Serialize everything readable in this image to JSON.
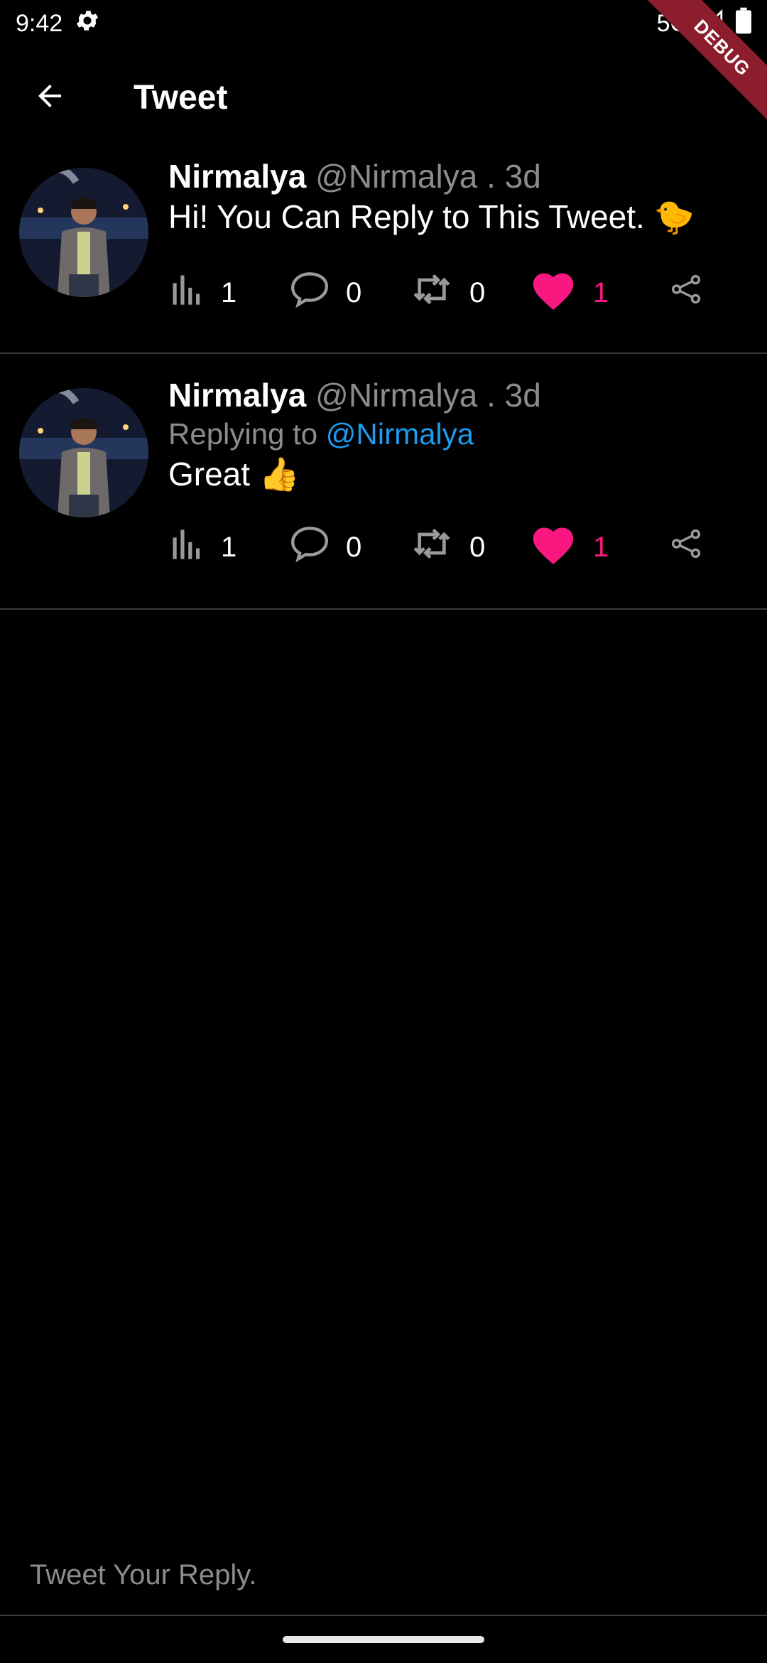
{
  "status_bar": {
    "time": "9:42",
    "network": "5G"
  },
  "debug_label": "DEBUG",
  "app_bar": {
    "title": "Tweet"
  },
  "tweets": [
    {
      "name": "Nirmalya",
      "handle_time": "@Nirmalya . 3d",
      "text": "Hi! You Can Reply to This Tweet. 🐤",
      "views": "1",
      "replies": "0",
      "retweets": "0",
      "likes": "1"
    },
    {
      "name": "Nirmalya",
      "handle_time": "@Nirmalya . 3d",
      "replying_prefix": "Replying to",
      "replying_to": "@Nirmalya",
      "text": "Great 👍",
      "views": "1",
      "replies": "0",
      "retweets": "0",
      "likes": "1"
    }
  ],
  "reply_box": {
    "placeholder": "Tweet Your Reply."
  },
  "colors": {
    "like": "#f91880",
    "mention": "#1d9bf0",
    "muted": "#8c8c8c"
  }
}
